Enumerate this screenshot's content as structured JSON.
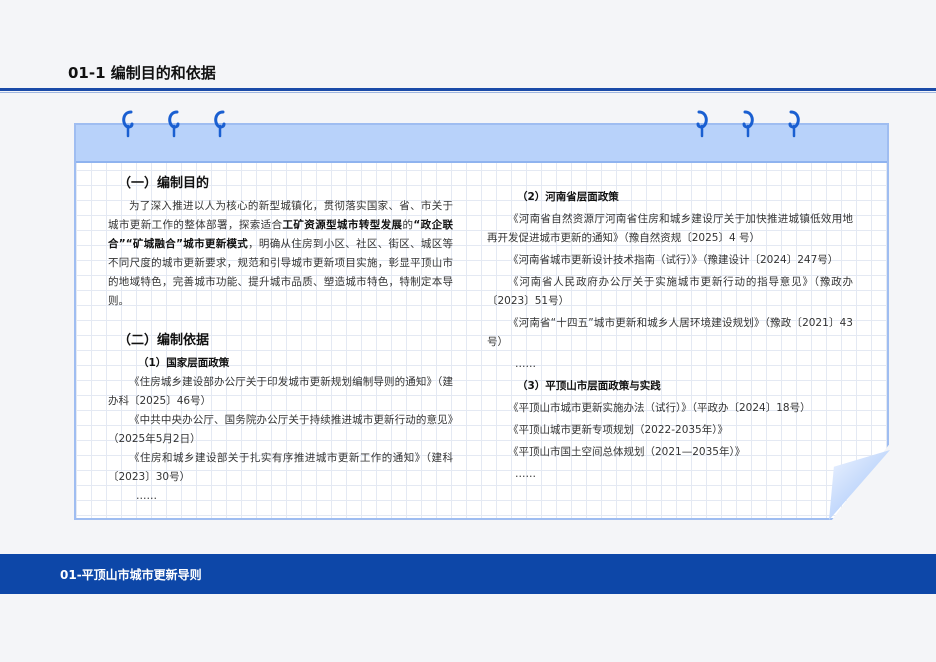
{
  "page": {
    "title": "01-1 编制目的和依据",
    "footer": "01-平顶山市城市更新导则"
  },
  "colors": {
    "accent": "#0d47a8",
    "header_band": "#b8d2fa",
    "border": "#9fbdf1"
  },
  "icons": {
    "binder_rings": "spiral-ring-icon"
  },
  "left": {
    "purpose_heading": "（一）编制目的",
    "purpose": {
      "t1": "为了深入推进以人为核心的新型城镇化，贯彻落实国家、省、市关于城市更新工作的整体部署，探索适合",
      "b1": "工矿资源型城市转型发展",
      "t2": "的",
      "b2": "“政企联合”“矿城融合”城市更新模式",
      "t3": "，明确从住房到小区、社区、街区、城区等不同尺度的城市更新要求，规范和引导城市更新项目实施，彰显平顶山市的地域特色，完善城市功能、提升城市品质、塑造城市特色，特制定本导则。"
    },
    "basis_heading": "（二）编制依据",
    "national_heading": "（1）国家层面政策",
    "national": [
      "《住房城乡建设部办公厅关于印发城市更新规划编制导则的通知》（建办科〔2025〕46号）",
      "《中共中央办公厅、国务院办公厅关于持续推进城市更新行动的意见》（2025年5月2日）",
      "《住房和城乡建设部关于扎实有序推进城市更新工作的通知》（建科〔2023〕30号）"
    ],
    "ellipsis": "……"
  },
  "right": {
    "henan_heading": "（2）河南省层面政策",
    "henan": [
      "《河南省自然资源厅河南省住房和城乡建设厅关于加快推进城镇低效用地再开发促进城市更新的通知》（豫自然资规〔2025〕4 号）",
      "《河南省城市更新设计技术指南（试行）》（豫建设计〔2024〕247号）",
      "《河南省人民政府办公厅关于实施城市更新行动的指导意见》（豫政办〔2023〕51号）",
      "《河南省“十四五”城市更新和城乡人居环境建设规划》（豫政〔2021〕43号）"
    ],
    "ellipsis1": "……",
    "pds_heading": "（3）平顶山市层面政策与实践",
    "pds": [
      "《平顶山市城市更新实施办法（试行）》（平政办〔2024〕18号）",
      "《平顶山城市更新专项规划（2022-2035年）》",
      "《平顶山市国土空间总体规划（2021—2035年）》"
    ],
    "ellipsis2": "……"
  }
}
